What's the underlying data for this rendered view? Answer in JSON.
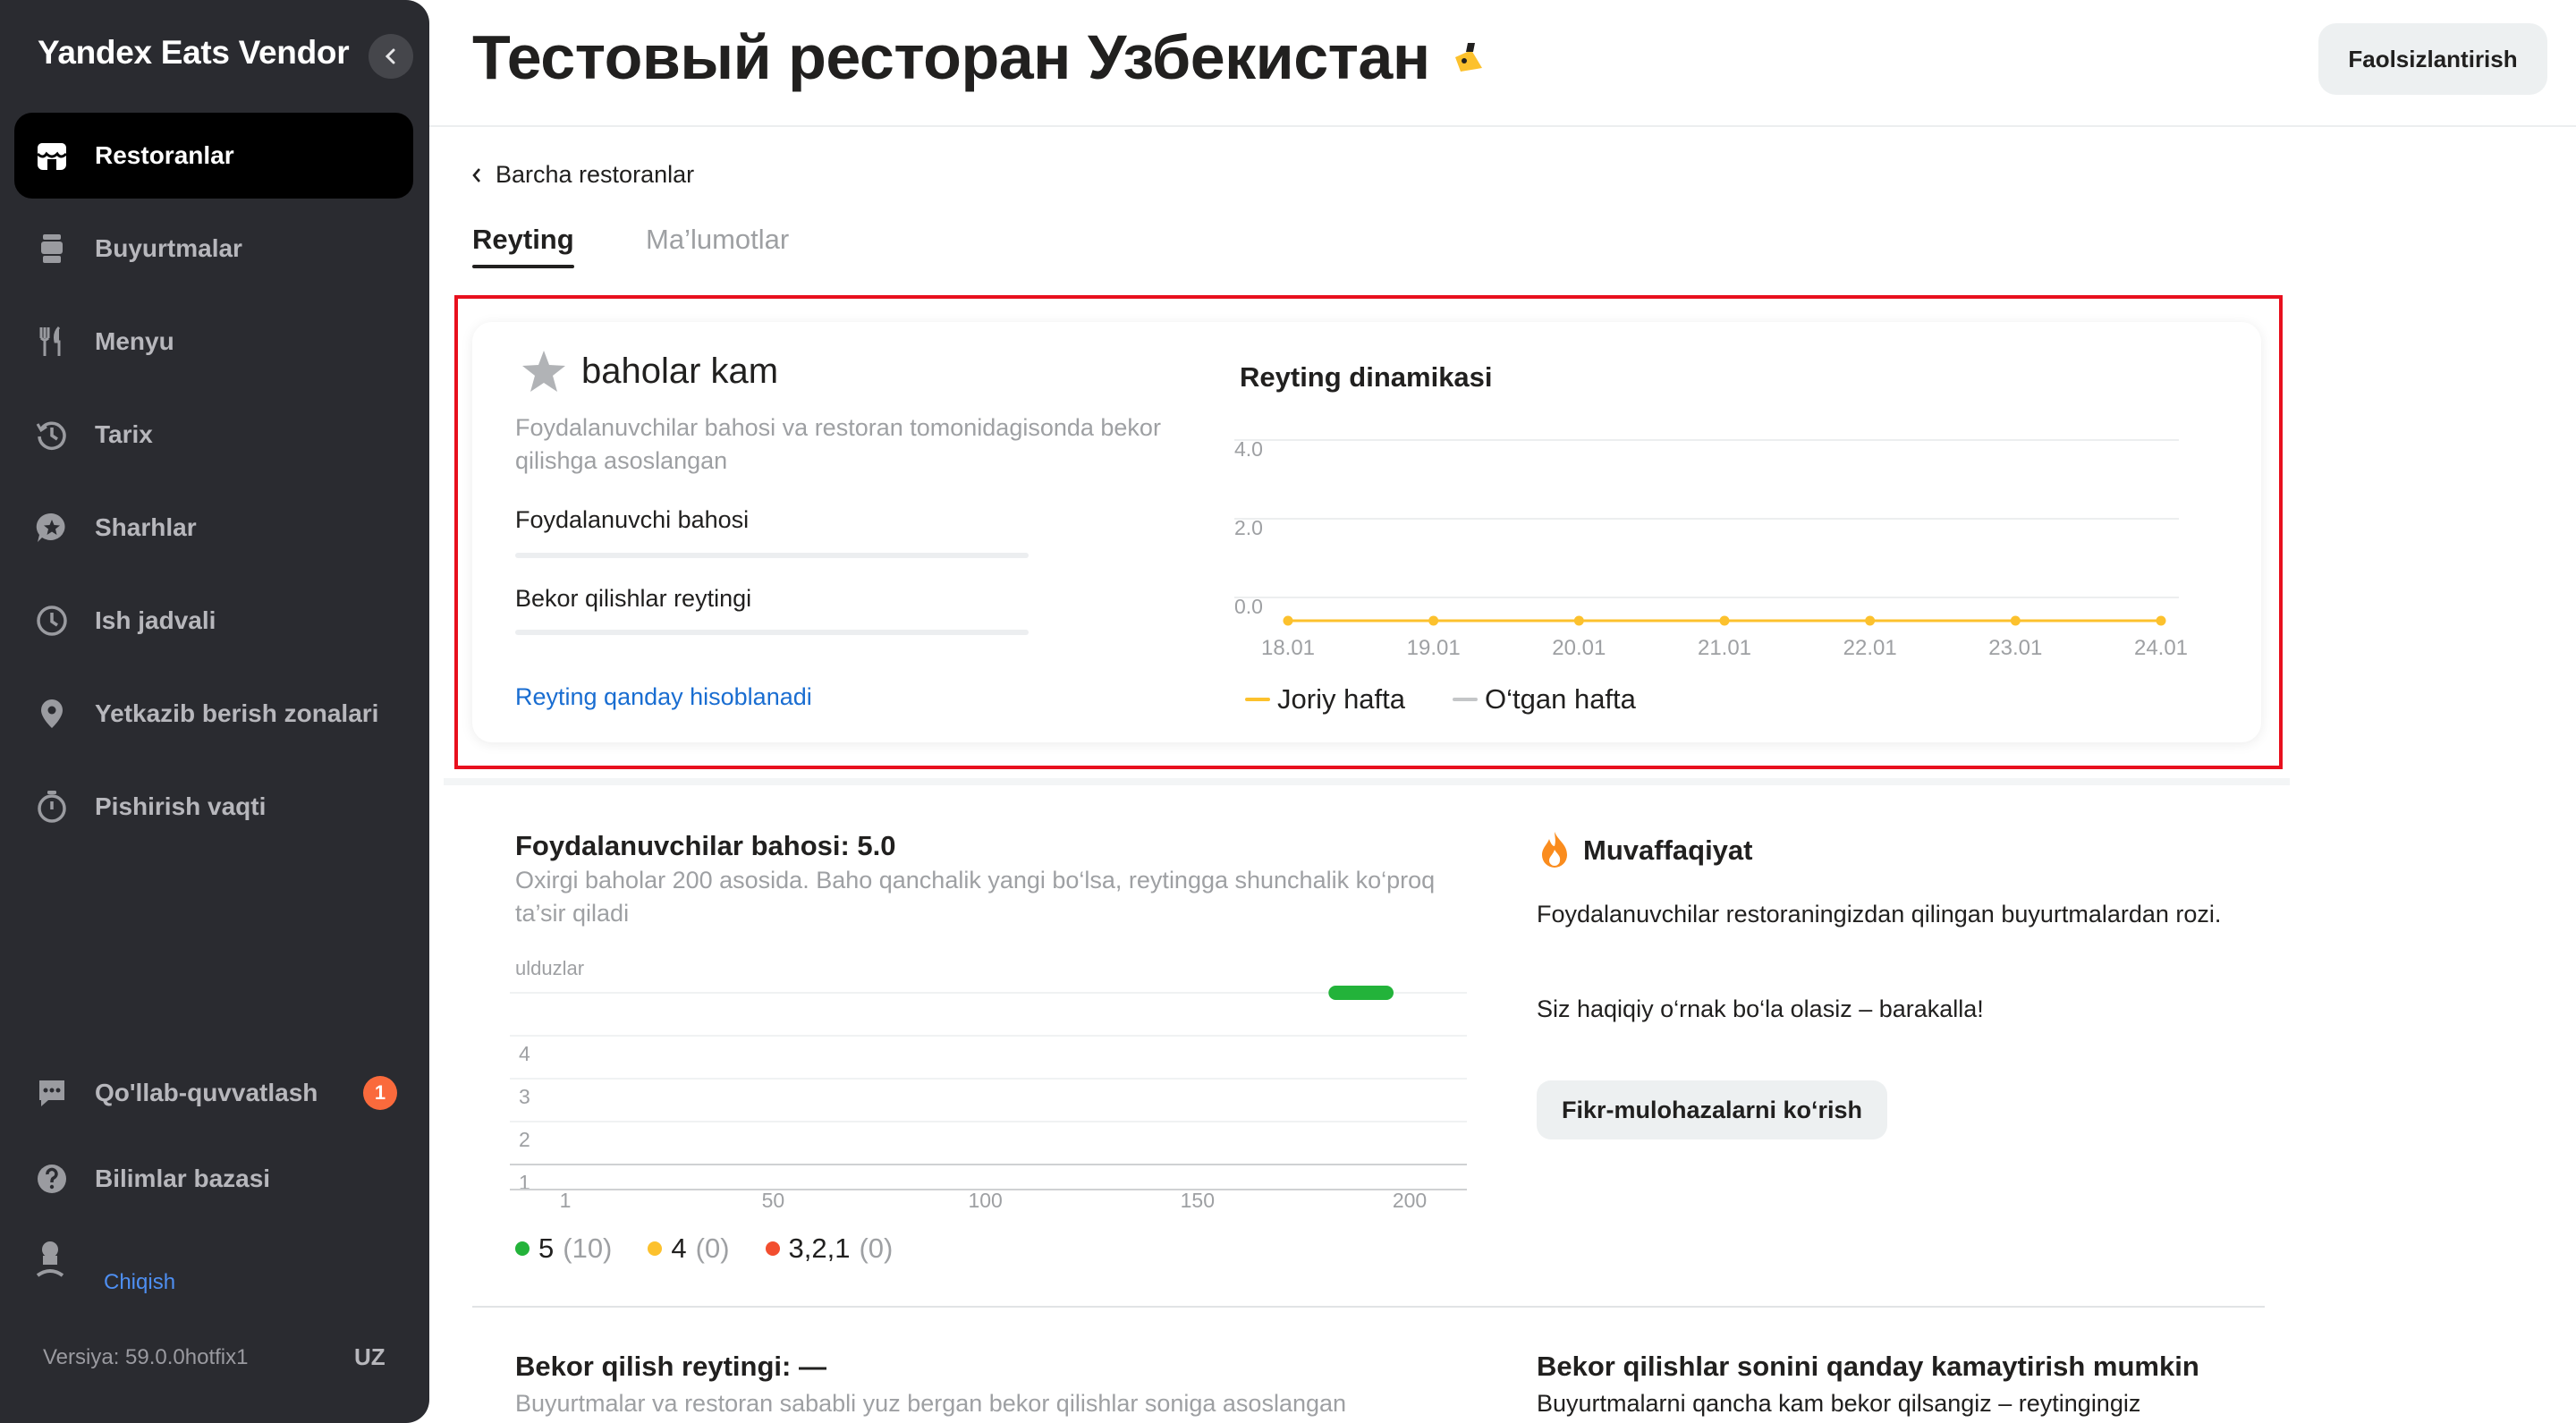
{
  "sidebar": {
    "brand": "Yandex Eats Vendor",
    "items": [
      {
        "label": "Restoranlar",
        "icon": "store-icon",
        "active": true
      },
      {
        "label": "Buyurtmalar",
        "icon": "order-bag-icon"
      },
      {
        "label": "Menyu",
        "icon": "fork-knife-icon"
      },
      {
        "label": "Tarix",
        "icon": "history-icon"
      },
      {
        "label": "Sharhlar",
        "icon": "review-star-icon"
      },
      {
        "label": "Ish jadvali",
        "icon": "clock-icon"
      },
      {
        "label": "Yetkazib berish zonalari",
        "icon": "location-pin-icon"
      },
      {
        "label": "Pishirish vaqti",
        "icon": "stopwatch-icon"
      }
    ],
    "support": {
      "label": "Qo'llab-quvvatlash",
      "badge": "1"
    },
    "knowledge": {
      "label": "Bilimlar bazasi"
    },
    "logout": "Chiqish",
    "version": "Versiya: 59.0.0hotfix1",
    "lang": "UZ"
  },
  "header": {
    "title": "Тестовый ресторан Узбекистан",
    "deactivate_label": "Faolsizlantirish"
  },
  "breadcrumb": "Barcha restoranlar",
  "tabs": [
    {
      "label": "Reyting",
      "active": true
    },
    {
      "label": "Ma’lumotlar",
      "active": false
    }
  ],
  "rating_card": {
    "status": "baholar kam",
    "description": "Foydalanuvchilar bahosi va restoran tomonidagisonda bekor qilishga asoslangan",
    "user_rating_label": "Foydalanuvchi bahosi",
    "cancel_rating_label": "Bekor qilishlar reytingi",
    "how_link": "Reyting qanday hisoblanadi",
    "dynamics_title": "Reyting dinamikasi",
    "legend_current": "Joriy hafta",
    "legend_previous": "O‘tgan hafta"
  },
  "user_rating": {
    "title": "Foydalanuvchilar bahosi: 5.0",
    "description": "Oxirgi baholar 200 asosida. Baho qanchalik yangi bo‘lsa, reytingga shunchalik ko‘proq ta’sir qiladi",
    "dist": [
      {
        "label": "5",
        "count": "(10)",
        "color": "#23b33a"
      },
      {
        "label": "4",
        "count": "(0)",
        "color": "#fcc12d"
      },
      {
        "label": "3,2,1",
        "count": "(0)",
        "color": "#f24e2f"
      }
    ]
  },
  "achievement": {
    "title": "Muvaffaqiyat",
    "text1": "Foydalanuvchilar restoraningizdan qilingan buyurtmalardan rozi.",
    "text2": "Siz haqiqiy o‘rnak bo‘la olasiz – barakalla!",
    "button": "Fikr-mulohazalarni ko‘rish"
  },
  "cancel_rating": {
    "title": "Bekor qilish reytingi:  —",
    "description": "Buyurtmalar va restoran sababli yuz bergan bekor qilishlar soniga asoslangan"
  },
  "reduce": {
    "title": "Bekor qilishlar sonini qanday kamaytirish mumkin",
    "description": "Buyurtmalarni qancha kam bekor qilsangiz – reytingingiz"
  },
  "chart_data": [
    {
      "type": "line",
      "title": "Reyting dinamikasi",
      "categories": [
        "18.01",
        "19.01",
        "20.01",
        "21.01",
        "22.01",
        "23.01",
        "24.01"
      ],
      "y_ticks": [
        "4.0",
        "2.0",
        "0.0"
      ],
      "ylim": [
        0,
        4
      ],
      "series": [
        {
          "name": "Joriy hafta",
          "color": "#fcc12d",
          "values": [
            0,
            0,
            0,
            0,
            0,
            0,
            0
          ]
        },
        {
          "name": "O‘tgan hafta",
          "color": "#c4c6c8",
          "values": []
        }
      ],
      "legend": "bottom-left"
    },
    {
      "type": "scatter",
      "ylabel": "ulduzlar",
      "x_ticks": [
        "1",
        "50",
        "100",
        "150",
        "200"
      ],
      "y_ticks": [
        "4",
        "3",
        "2",
        "1"
      ],
      "xlim": [
        1,
        200
      ],
      "ylim": [
        1,
        5
      ],
      "series": [
        {
          "name": "5",
          "color": "#23b33a",
          "x_range": [
            191,
            200
          ],
          "y": 5
        }
      ]
    }
  ]
}
